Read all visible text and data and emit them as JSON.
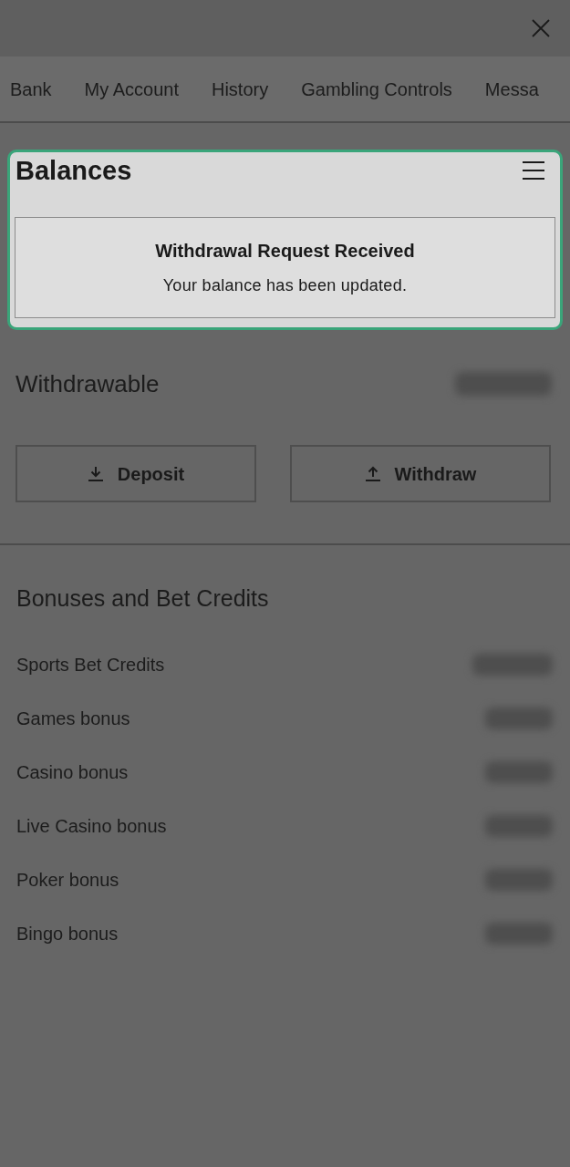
{
  "nav": {
    "items": [
      "Bank",
      "My Account",
      "History",
      "Gambling Controls",
      "Messa"
    ]
  },
  "balances_card": {
    "title": "Balances",
    "highlighted": true,
    "notice": {
      "title": "Withdrawal Request Received",
      "message": "Your balance has been updated."
    }
  },
  "withdrawable": {
    "label": "Withdrawable"
  },
  "actions": [
    {
      "label": "Deposit",
      "kind": "deposit"
    },
    {
      "label": "Withdraw",
      "kind": "withdraw"
    }
  ],
  "bonuses": {
    "title": "Bonuses and Bet Credits",
    "rows": [
      {
        "label": "Sports Bet Credits"
      },
      {
        "label": "Games bonus"
      },
      {
        "label": "Casino bonus"
      },
      {
        "label": "Live Casino bonus"
      },
      {
        "label": "Poker bonus"
      },
      {
        "label": "Bingo bonus"
      }
    ]
  }
}
